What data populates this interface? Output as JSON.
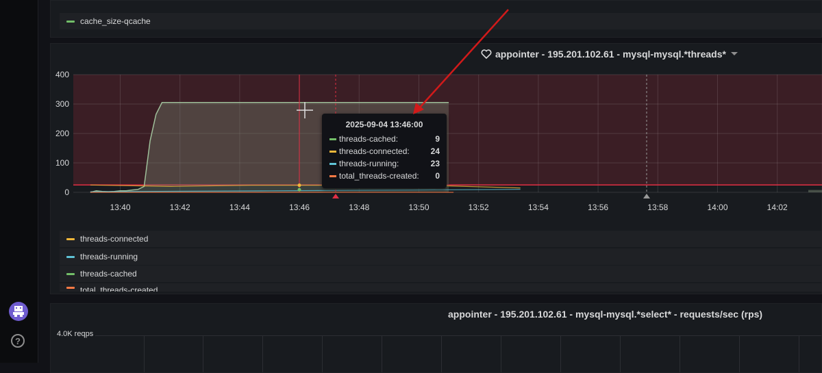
{
  "panel_top": {
    "legend": [
      {
        "name": "cache_size-qcache",
        "color": "#73bf69"
      }
    ]
  },
  "panel_threads": {
    "title": "appointer - 195.201.102.61 - mysql-mysql.*threads*",
    "icons": {
      "title_icon": "heart-icon",
      "menu_icon": "caret-down-icon"
    },
    "legend": [
      {
        "name": "threads-connected",
        "color": "#f2b83a"
      },
      {
        "name": "threads-running",
        "color": "#5fc3d6"
      },
      {
        "name": "threads-cached",
        "color": "#73bf69"
      },
      {
        "name": "total_threads-created",
        "color": "#ff7a45"
      }
    ],
    "tooltip": {
      "time": "2025-09-04 13:46:00",
      "rows": [
        {
          "name": "threads-cached:",
          "value": "9",
          "color": "#73bf69"
        },
        {
          "name": "threads-connected:",
          "value": "24",
          "color": "#f2b83a"
        },
        {
          "name": "threads-running:",
          "value": "23",
          "color": "#5fc3d6"
        },
        {
          "name": "total_threads-created:",
          "value": "0",
          "color": "#ff7a45"
        }
      ]
    },
    "threshold": {
      "value": 25,
      "color": "#e02f44"
    }
  },
  "panel_select": {
    "title": "appointer - 195.201.102.61 - mysql-mysql.*select* - requests/sec (rps)",
    "y_label_top": "4.0K reqps"
  },
  "chart_data": {
    "type": "line",
    "title": "appointer - 195.201.102.61 - mysql-mysql.*threads*",
    "x_ticks": [
      "13:40",
      "13:42",
      "13:44",
      "13:46",
      "13:48",
      "13:50",
      "13:52",
      "13:54",
      "13:56",
      "13:58",
      "14:00",
      "14:02"
    ],
    "y_ticks": [
      "0",
      "100",
      "200",
      "300",
      "400"
    ],
    "ylim": [
      0,
      400
    ],
    "grid": true,
    "legend_position": "bottom",
    "series": [
      {
        "name": "threads-cached",
        "color": "#73bf69",
        "fill": true,
        "points": [
          [
            0,
            0
          ],
          [
            1,
            5
          ],
          [
            2,
            3
          ],
          [
            3,
            2
          ],
          [
            4,
            3
          ],
          [
            5,
            5
          ],
          [
            6,
            5
          ],
          [
            7,
            8
          ],
          [
            8,
            10
          ],
          [
            9,
            20
          ],
          [
            10,
            175
          ],
          [
            11,
            265
          ],
          [
            12,
            305
          ],
          [
            13,
            305
          ],
          [
            14,
            305
          ],
          [
            15,
            305
          ],
          [
            16,
            305
          ],
          [
            17,
            305
          ],
          [
            18,
            305
          ],
          [
            19,
            305
          ],
          [
            20,
            305
          ],
          [
            21,
            305
          ],
          [
            22,
            305
          ],
          [
            23,
            305
          ],
          [
            24,
            305
          ],
          [
            25,
            305
          ],
          [
            26,
            305
          ],
          [
            27,
            305
          ],
          [
            28,
            305
          ],
          [
            29,
            305
          ],
          [
            30,
            305
          ],
          [
            31,
            305
          ],
          [
            32,
            305
          ],
          [
            33,
            305
          ],
          [
            34,
            305
          ],
          [
            35,
            305
          ],
          [
            36,
            305
          ],
          [
            37,
            305
          ],
          [
            38,
            305
          ],
          [
            39,
            305
          ],
          [
            40,
            305
          ],
          [
            41,
            305
          ],
          [
            42,
            305
          ],
          [
            43,
            305
          ],
          [
            44,
            305
          ],
          [
            45,
            305
          ],
          [
            46,
            305
          ],
          [
            47,
            305
          ],
          [
            48,
            305
          ],
          [
            49,
            305
          ],
          [
            50,
            305
          ],
          [
            51,
            305
          ],
          [
            52,
            305
          ],
          [
            53,
            305
          ],
          [
            54,
            305
          ],
          [
            55,
            305
          ],
          [
            56,
            305
          ],
          [
            57,
            305
          ],
          [
            58,
            305
          ],
          [
            59,
            305
          ],
          [
            60,
            305
          ],
          [
            61,
            305
          ],
          [
            62,
            305
          ],
          [
            63,
            305
          ],
          [
            64,
            305
          ],
          [
            65,
            305
          ],
          [
            66,
            305
          ],
          [
            67,
            305
          ],
          [
            68,
            305
          ],
          [
            69,
            305
          ],
          [
            70,
            305
          ],
          [
            71,
            305
          ],
          [
            72,
            305
          ],
          [
            73,
            305
          ],
          [
            74,
            305
          ],
          [
            75,
            305
          ],
          [
            76,
            305
          ],
          [
            77,
            305
          ],
          [
            78,
            305
          ],
          [
            79,
            305
          ],
          [
            80,
            305
          ],
          [
            81,
            305
          ],
          [
            82,
            305
          ],
          [
            83,
            305
          ],
          [
            84,
            305
          ],
          [
            85,
            305
          ],
          [
            86,
            305
          ],
          [
            87,
            305
          ],
          [
            88,
            305
          ],
          [
            89,
            305
          ],
          [
            90,
            305
          ],
          [
            91,
            305
          ],
          [
            92,
            305
          ],
          [
            93,
            305
          ],
          [
            94,
            305
          ],
          [
            95,
            305
          ],
          [
            96,
            305
          ],
          [
            97,
            305
          ],
          [
            98,
            305
          ],
          [
            99,
            305
          ],
          [
            100,
            305
          ],
          [
            101,
            305
          ],
          [
            102,
            305
          ],
          [
            103,
            305
          ],
          [
            104,
            305
          ],
          [
            105,
            305
          ],
          [
            106,
            305
          ],
          [
            107,
            305
          ],
          [
            108,
            305
          ],
          [
            109,
            305
          ],
          [
            110,
            305
          ],
          [
            111,
            305
          ],
          [
            112,
            305
          ],
          [
            113,
            305
          ],
          [
            114,
            305
          ],
          [
            115,
            305
          ],
          [
            116,
            305
          ],
          [
            117,
            305
          ],
          [
            118,
            305
          ],
          [
            119,
            305
          ],
          [
            120,
            305
          ]
        ]
      },
      {
        "name": "threads-connected",
        "color": "#f2b83a",
        "fill": false,
        "points": [
          [
            0,
            25
          ],
          [
            3,
            20
          ],
          [
            6,
            24
          ],
          [
            9,
            24
          ],
          [
            12,
            25
          ],
          [
            14,
            20
          ],
          [
            16,
            15
          ]
        ]
      },
      {
        "name": "threads-running",
        "color": "#5fc3d6",
        "fill": false,
        "points": [
          [
            0,
            2
          ],
          [
            5,
            5
          ],
          [
            9,
            8
          ],
          [
            12,
            10
          ]
        ]
      },
      {
        "name": "total_threads-created",
        "color": "#ff7a45",
        "fill": false,
        "points": [
          [
            0,
            0
          ],
          [
            16,
            0
          ]
        ]
      }
    ]
  }
}
